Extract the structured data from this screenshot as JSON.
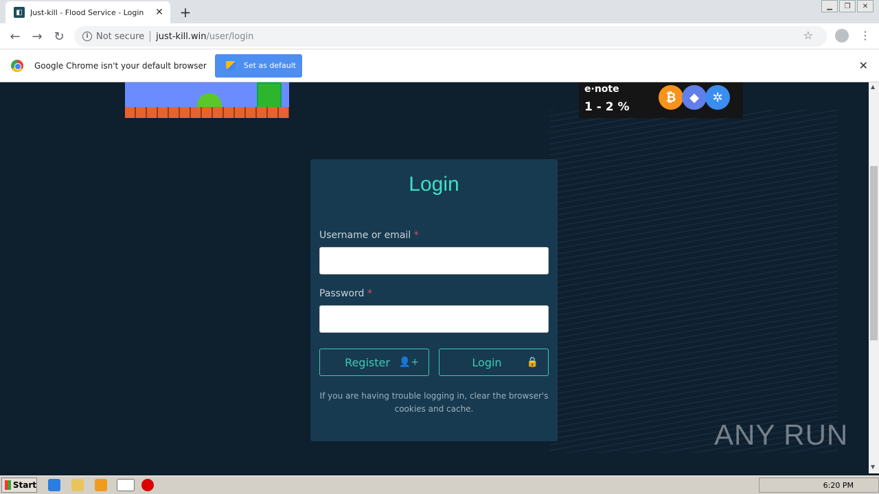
{
  "browser": {
    "tab_title": "Just-kill - Flood Service - Login",
    "new_tab_label": "+",
    "security_label": "Not secure",
    "url_host": "just-kill.win",
    "url_path": "/user/login"
  },
  "infobar": {
    "message": "Google Chrome isn't your default browser",
    "button_label": "Set as default"
  },
  "ads": {
    "right_brand": "e·note",
    "right_text": "1 - 2 %"
  },
  "login": {
    "title": "Login",
    "username_label": "Username or email",
    "password_label": "Password",
    "required_marker": "*",
    "register_button": "Register",
    "login_button": "Login",
    "help_text": "If you are having trouble logging in, clear the browser's cookies and cache."
  },
  "watermark": "ANY RUN",
  "taskbar": {
    "start_label": "Start",
    "clock": "6:20 PM"
  },
  "colors": {
    "page_bg": "#0e1f2e",
    "card_bg": "#173a50",
    "accent": "#3fe0c5",
    "chrome_blue": "#4d8ef0"
  }
}
